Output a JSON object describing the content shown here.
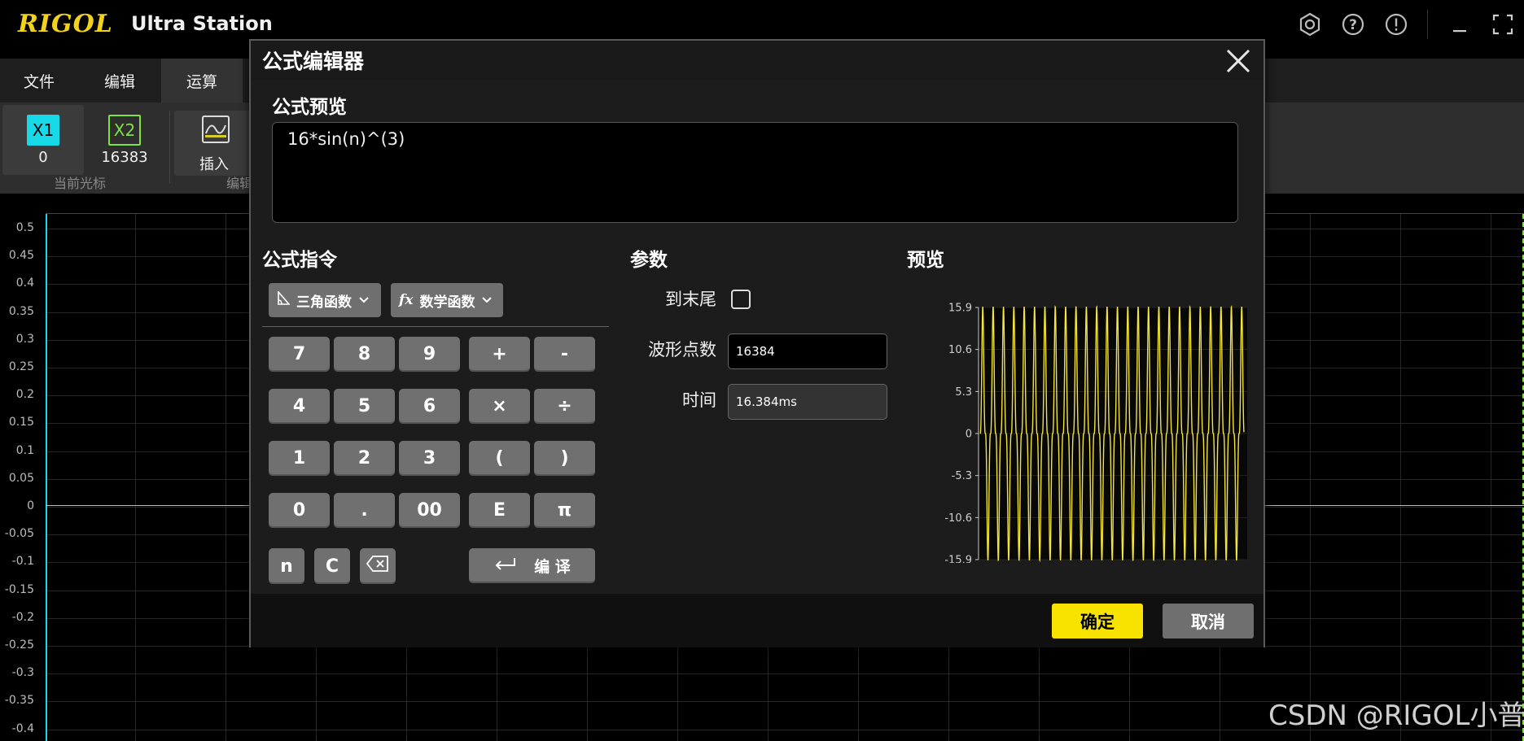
{
  "app": {
    "logo": "RIGOL",
    "title": "Ultra Station"
  },
  "window_controls": [
    "settings-icon",
    "help-icon",
    "info-icon",
    "minimize-icon",
    "maximize-icon"
  ],
  "menu": {
    "tabs": [
      "文件",
      "编辑",
      "运算"
    ],
    "active": "运算"
  },
  "ribbon": {
    "cursor_x1": {
      "label": "X1",
      "value": "0"
    },
    "cursor_x2": {
      "label": "X2",
      "value": "16383"
    },
    "group_cursor": "当前光标",
    "insert_label": "插入",
    "group_edit": "编辑"
  },
  "scope": {
    "y_ticks": [
      "0.5",
      "0.45",
      "0.4",
      "0.35",
      "0.3",
      "0.25",
      "0.2",
      "0.15",
      "0.1",
      "0.05",
      "0",
      "-0.05",
      "-0.1",
      "-0.15",
      "-0.2",
      "-0.25",
      "-0.3",
      "-0.35",
      "-0.4"
    ]
  },
  "dialog": {
    "title": "公式编辑器",
    "preview_title": "公式预览",
    "formula": "16*sin(n)^(3)",
    "commands_title": "公式指令",
    "dropdowns": [
      "三角函数",
      "数学函数"
    ],
    "keypad": [
      [
        "7",
        "8",
        "9",
        "+",
        "-"
      ],
      [
        "4",
        "5",
        "6",
        "×",
        "÷"
      ],
      [
        "1",
        "2",
        "3",
        "(",
        ")"
      ],
      [
        "0",
        ".",
        "00",
        "E",
        "π"
      ]
    ],
    "extra_keys": [
      "n",
      "C"
    ],
    "compile_label": "编 译",
    "params_title": "参数",
    "to_end_label": "到末尾",
    "to_end_checked": false,
    "points_label": "波形点数",
    "points_value": "16384",
    "time_label": "时间",
    "time_value": "16.384ms",
    "wave_preview_title": "预览",
    "ok": "确定",
    "cancel": "取消"
  },
  "chart_data": {
    "type": "line",
    "formula": "16*sin(n)^(3)",
    "y_ticks": [
      "15.9",
      "10.6",
      "5.3",
      "0",
      "-5.3",
      "-10.6",
      "-15.9"
    ],
    "ylim": [
      -15.9,
      15.9
    ],
    "series_color": "#f3e33a"
  },
  "watermark": "CSDN @RIGOL小普"
}
